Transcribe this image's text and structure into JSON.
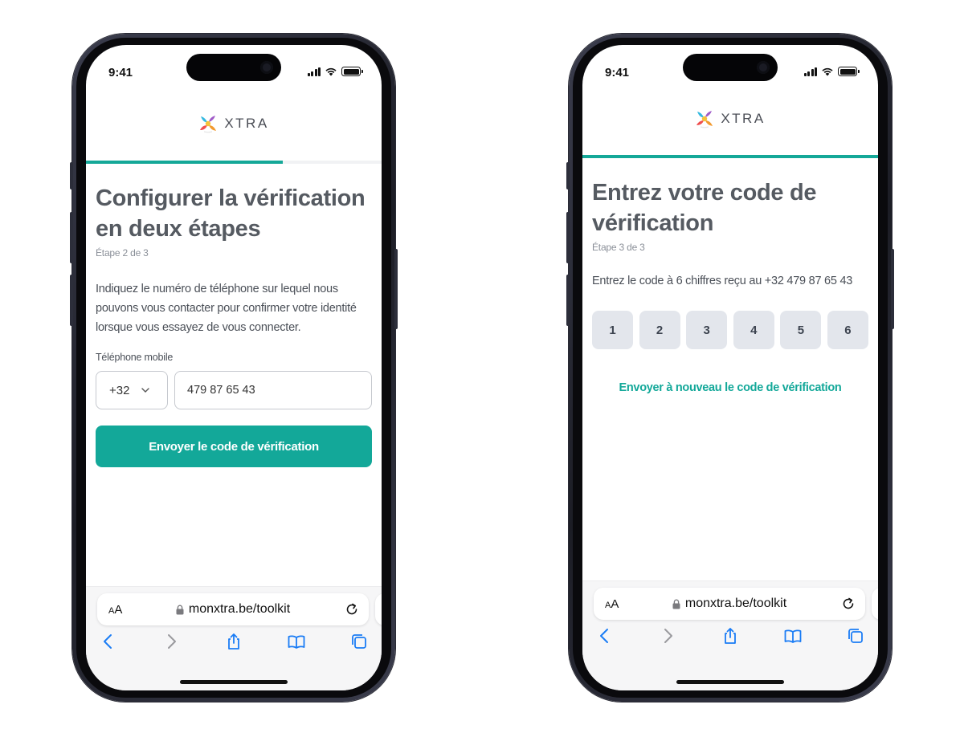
{
  "colors": {
    "accent": "#13a899",
    "heading": "#555a61",
    "muted": "#8a8f98",
    "code_box_bg": "#e3e6ec"
  },
  "screens": [
    {
      "status": {
        "time": "9:41"
      },
      "brand": {
        "name": "XTRA"
      },
      "progress": {
        "fraction": 0.667
      },
      "title": "Configurer la vérification en deux étapes",
      "step_label": "Étape 2 de 3",
      "description": "Indiquez le numéro de téléphone sur lequel nous pouvons vous contacter pour confirmer votre identité lorsque vous essayez de vous connecter.",
      "phone_field": {
        "label": "Téléphone mobile",
        "country_code": "+32",
        "value": "479 87 65 43"
      },
      "submit_label": "Envoyer le code de vérification",
      "browser": {
        "aa_label": "AA",
        "url": "monxtra.be/toolkit"
      }
    },
    {
      "status": {
        "time": "9:41"
      },
      "brand": {
        "name": "XTRA"
      },
      "progress": {
        "fraction": 1.0
      },
      "title": "Entrez votre code de vérification",
      "step_label": "Étape 3 de 3",
      "description": "Entrez le code à 6 chiffres reçu au +32 479 87 65 43",
      "code_digits": [
        "1",
        "2",
        "3",
        "4",
        "5",
        "6"
      ],
      "resend_label": "Envoyer à nouveau le code de vérification",
      "browser": {
        "aa_label": "AA",
        "url": "monxtra.be/toolkit"
      }
    }
  ],
  "icons": {
    "logo": "xtra-logo-mark",
    "signal": "cellular-signal-icon",
    "wifi": "wifi-icon",
    "battery": "battery-icon",
    "lock": "lock-icon",
    "reload": "reload-icon",
    "back": "back-chevron-icon",
    "forward": "forward-chevron-icon",
    "share": "share-icon",
    "bookmarks": "bookmarks-icon",
    "tabs": "tabs-icon",
    "dropdown": "chevron-down-icon"
  }
}
